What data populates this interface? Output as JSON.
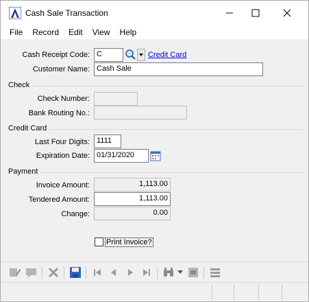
{
  "window": {
    "title": "Cash Sale Transaction"
  },
  "menu": {
    "items": [
      "File",
      "Record",
      "Edit",
      "View",
      "Help"
    ]
  },
  "receipt": {
    "code_label": "Cash Receipt Code:",
    "code_value": "C",
    "code_link": "Credit Card",
    "customer_label": "Customer Name:",
    "customer_value": "Cash Sale"
  },
  "check": {
    "section_label": "Check",
    "number_label": "Check Number:",
    "number_value": "",
    "routing_label": "Bank Routing No.:",
    "routing_value": ""
  },
  "credit_card": {
    "section_label": "Credit Card",
    "last_four_label": "Last Four Digits:",
    "last_four_value": "1111",
    "expiration_label": "Expiration Date:",
    "expiration_value": "01/31/2020"
  },
  "payment": {
    "section_label": "Payment",
    "invoice_label": "Invoice Amount:",
    "invoice_value": "1,113.00",
    "tendered_label": "Tendered Amount:",
    "tendered_value": "1,113.00",
    "change_label": "Change:",
    "change_value": "0.00"
  },
  "print_invoice": {
    "label": "Print Invoice?",
    "checked": false
  },
  "toolbar": {
    "icons": [
      "edit-note-icon",
      "comment-icon",
      "delete-icon",
      "save-icon",
      "first-record-icon",
      "previous-record-icon",
      "next-record-icon",
      "last-record-icon",
      "binoculars-icon",
      "dropdown-arrow-icon",
      "export-icon",
      "list-icon"
    ]
  }
}
